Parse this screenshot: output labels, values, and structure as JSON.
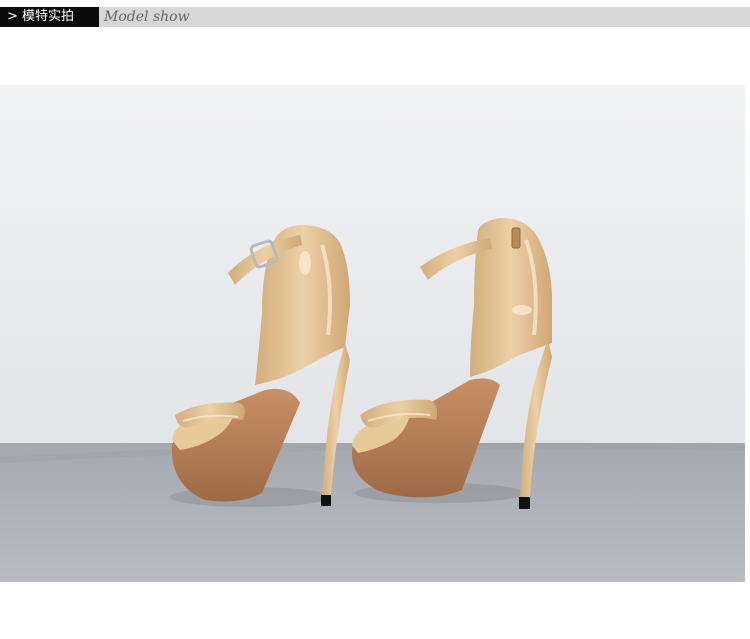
{
  "header": {
    "tag_label": "> 模特实拍",
    "subtitle": "Model show"
  },
  "colors": {
    "header_bg": "#d7d7d7",
    "tag_bg": "#0b0b0b",
    "backdrop": "#eceef0",
    "floor": "#aeb1b7",
    "shoe_patent": "#e2c193",
    "sole": "#b77f55"
  },
  "photo": {
    "subject": "nude-patent-platform-sandals-icon"
  }
}
